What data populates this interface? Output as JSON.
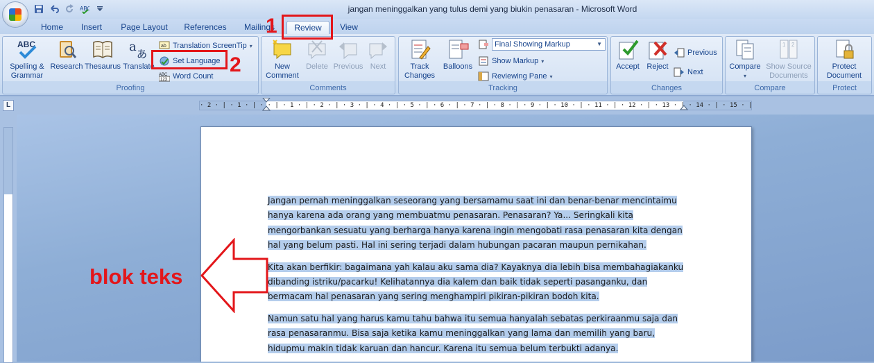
{
  "window": {
    "title": "jangan meninggalkan yang tulus demi yang biukin penasaran - Microsoft Word"
  },
  "quick_access": [
    "save-icon",
    "undo-icon",
    "redo-icon",
    "spelling-icon",
    "customize-icon"
  ],
  "tabs": [
    {
      "label": "Home"
    },
    {
      "label": "Insert"
    },
    {
      "label": "Page Layout"
    },
    {
      "label": "References"
    },
    {
      "label": "Mailings"
    },
    {
      "label": "Review"
    },
    {
      "label": "View"
    }
  ],
  "ribbon": {
    "proofing": {
      "label": "Proofing",
      "spelling": "Spelling &\nGrammar",
      "research": "Research",
      "thesaurus": "Thesaurus",
      "translate": "Translate",
      "translation_screentip": "Translation ScreenTip",
      "set_language": "Set Language",
      "word_count": "Word Count"
    },
    "comments": {
      "label": "Comments",
      "new_comment": "New\nComment",
      "delete": "Delete",
      "previous": "Previous",
      "next": "Next"
    },
    "tracking": {
      "label": "Tracking",
      "track_changes": "Track\nChanges",
      "balloons": "Balloons",
      "markup_select": "Final Showing Markup",
      "show_markup": "Show Markup",
      "reviewing_pane": "Reviewing Pane"
    },
    "changes": {
      "label": "Changes",
      "accept": "Accept",
      "reject": "Reject",
      "previous": "Previous",
      "next": "Next"
    },
    "compare": {
      "label": "Compare",
      "compare": "Compare",
      "show_source": "Show Source\nDocuments"
    },
    "protect": {
      "label": "Protect",
      "protect_document": "Protect\nDocument"
    }
  },
  "ruler": {
    "tab_selector": "L",
    "ticks": "· 2 · | · 1 · | ·   · | · 1 · | · 2 · | · 3 · | · 4 · | · 5 · | · 6 · | · 7 · | · 8 · | · 9 · | · 10 · | · 11 · | · 12 · | · 13 · | · 14 · | · 15 · | · 16 · |   · 18 ·"
  },
  "document": {
    "paragraphs": [
      "Jangan pernah meninggalkan seseorang yang bersamamu saat ini dan benar-benar mencintaimu hanya karena ada orang yang membuatmu penasaran. Penasaran? Ya... Seringkali kita mengorbankan sesuatu yang berharga hanya karena ingin mengobati rasa penasaran kita dengan hal yang belum pasti. Hal ini sering terjadi dalam hubungan pacaran maupun pernikahan.",
      "Kita akan berfikir: bagaimana yah kalau aku sama dia? Kayaknya dia lebih bisa membahagiakanku dibanding istriku/pacarku! Kelihatannya dia kalem dan baik tidak seperti pasanganku, dan bermacam hal penasaran yang sering menghampiri pikiran-pikiran bodoh kita.",
      "Namun satu hal yang harus kamu tahu bahwa itu semua hanyalah sebatas perkiraanmu saja dan rasa penasaranmu. Bisa saja ketika kamu meninggalkan yang lama dan memilih yang baru, hidupmu makin tidak karuan dan hancur. Karena itu semua belum terbukti adanya."
    ]
  },
  "annotations": {
    "step1": "1",
    "step2": "2",
    "label": "blok teks",
    "color": "#e3161a"
  }
}
